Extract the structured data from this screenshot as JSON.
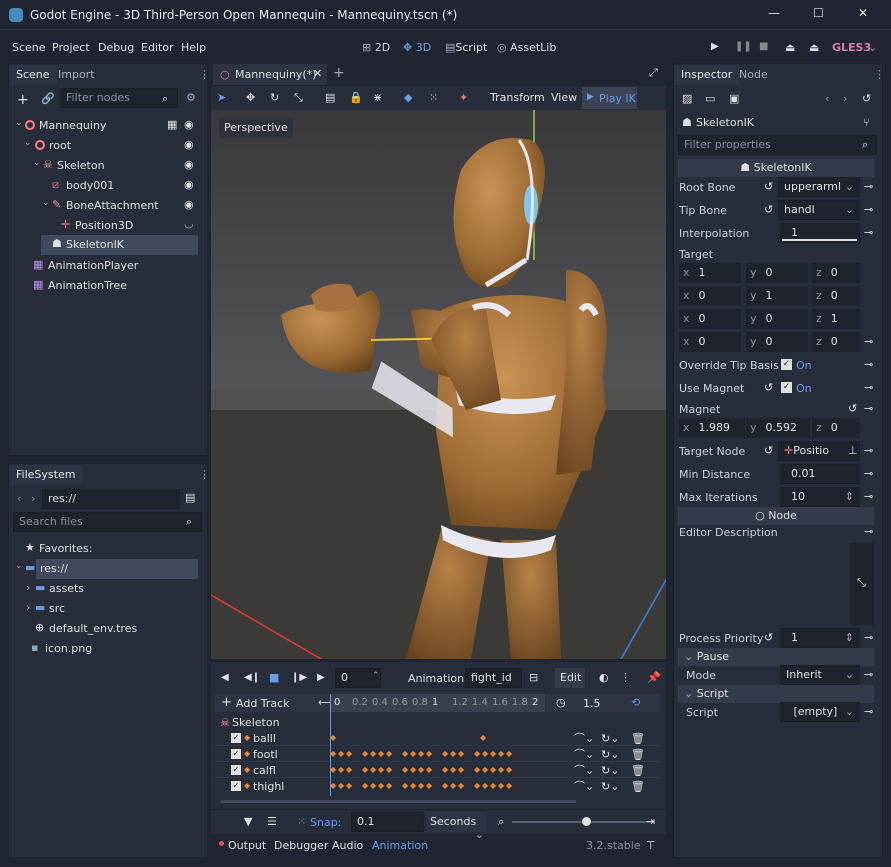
{
  "window": {
    "title": "Godot Engine - 3D Third-Person Open Mannequin - Mannequiny.tscn (*)",
    "minimize": "—",
    "maximize": "☐",
    "close": "✕"
  },
  "menu": [
    "Scene",
    "Project",
    "Debug",
    "Editor",
    "Help"
  ],
  "workspaces": {
    "2d": "2D",
    "3d": "3D",
    "script": "Script",
    "assetlib": "AssetLib"
  },
  "renderer": "GLES3",
  "scene_dock": {
    "tabs": [
      "Scene",
      "Import"
    ],
    "filter_placeholder": "Filter nodes",
    "tree": [
      {
        "label": "Mannequiny"
      },
      {
        "label": "root"
      },
      {
        "label": "Skeleton"
      },
      {
        "label": "body001"
      },
      {
        "label": "BoneAttachment"
      },
      {
        "label": "Position3D"
      },
      {
        "label": "SkeletonIK"
      },
      {
        "label": "AnimationPlayer"
      },
      {
        "label": "AnimationTree"
      }
    ]
  },
  "filesystem": {
    "tab": "FileSystem",
    "path": "res://",
    "search_placeholder": "Search files",
    "items": [
      "Favorites:",
      "res://",
      "assets",
      "src",
      "default_env.tres",
      "icon.png"
    ]
  },
  "editor": {
    "tab": "Mannequiny(*)",
    "toolbar": {
      "transform": "Transform",
      "view": "View",
      "play_ik": "Play IK"
    },
    "perspective": "Perspective"
  },
  "animation": {
    "frame": "0",
    "animation_label": "Animation",
    "current": "fight_id",
    "edit": "Edit",
    "add_track": "Add Track",
    "ruler": [
      "0",
      "0.2",
      "0.4",
      "0.6",
      "0.8",
      "1",
      "1.2",
      "1.4",
      "1.6",
      "1.8",
      "2"
    ],
    "length": "1.5",
    "skeleton": "Skeleton",
    "tracks": [
      "balll",
      "footl",
      "calfl",
      "thighl"
    ],
    "snap_label": "Snap:",
    "snap_value": "0.1",
    "snap_mode": "Seconds"
  },
  "bottom_tabs": [
    "Output",
    "Debugger",
    "Audio",
    "Animation"
  ],
  "version": "3.2.stable",
  "inspector": {
    "tabs": [
      "Inspector",
      "Node"
    ],
    "object": "SkeletonIK",
    "filter_placeholder": "Filter properties",
    "class_header": "SkeletonIK",
    "props": {
      "root_bone": {
        "label": "Root Bone",
        "value": "upperarml"
      },
      "tip_bone": {
        "label": "Tip Bone",
        "value": "handl"
      },
      "interpolation": {
        "label": "Interpolation",
        "value": "1"
      },
      "target": {
        "label": "Target",
        "rows": [
          [
            "1",
            "0",
            "0"
          ],
          [
            "0",
            "1",
            "0"
          ],
          [
            "0",
            "0",
            "1"
          ],
          [
            "0",
            "0",
            "0"
          ]
        ]
      },
      "override_tip_basis": {
        "label": "Override Tip Basis",
        "value": "On"
      },
      "use_magnet": {
        "label": "Use Magnet",
        "value": "On"
      },
      "magnet": {
        "label": "Magnet",
        "x": "1.989",
        "y": "0.592",
        "z": "0"
      },
      "target_node": {
        "label": "Target Node",
        "value": "Positio"
      },
      "min_distance": {
        "label": "Min Distance",
        "value": "0.01"
      },
      "max_iterations": {
        "label": "Max Iterations",
        "value": "10"
      }
    },
    "node_header": "Node",
    "editor_description": "Editor Description",
    "process_priority": {
      "label": "Process Priority",
      "value": "1"
    },
    "pause": {
      "header": "Pause",
      "mode_label": "Mode",
      "mode_value": "Inherit"
    },
    "script": {
      "header": "Script",
      "label": "Script",
      "value": "[empty]"
    }
  },
  "colors": {
    "accent": "#699ce8",
    "bg": "#202531",
    "panel": "#272d3a",
    "keyframe": "#e58a3f",
    "gles": "#d77eac"
  }
}
